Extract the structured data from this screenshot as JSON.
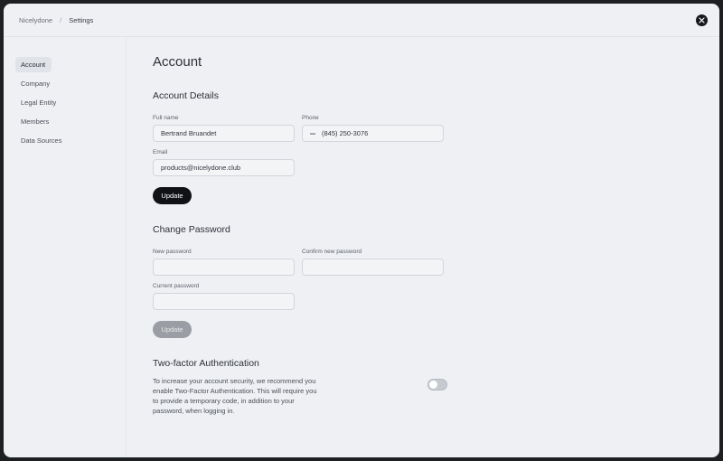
{
  "breadcrumb": {
    "root": "Nicelydone",
    "separator": "/",
    "current": "Settings"
  },
  "sidebar": {
    "items": [
      {
        "label": "Account"
      },
      {
        "label": "Company"
      },
      {
        "label": "Legal Entity"
      },
      {
        "label": "Members"
      },
      {
        "label": "Data Sources"
      }
    ]
  },
  "main": {
    "title": "Account",
    "account_details": {
      "heading": "Account Details",
      "full_name_label": "Full name",
      "full_name_value": "Bertrand Bruandet",
      "phone_label": "Phone",
      "phone_value": "(845) 250-3076",
      "email_label": "Email",
      "email_value": "products@nicelydone.club",
      "update_label": "Update"
    },
    "change_password": {
      "heading": "Change Password",
      "new_label": "New password",
      "confirm_label": "Confirm new password",
      "current_label": "Current password",
      "update_label": "Update"
    },
    "two_factor": {
      "heading": "Two-factor Authentication",
      "description": "To increase your account security, we recommend you enable Two-Factor Authentication. This will require you to provide a temporary code, in addition to your password, when logging in.",
      "enabled": false
    }
  }
}
